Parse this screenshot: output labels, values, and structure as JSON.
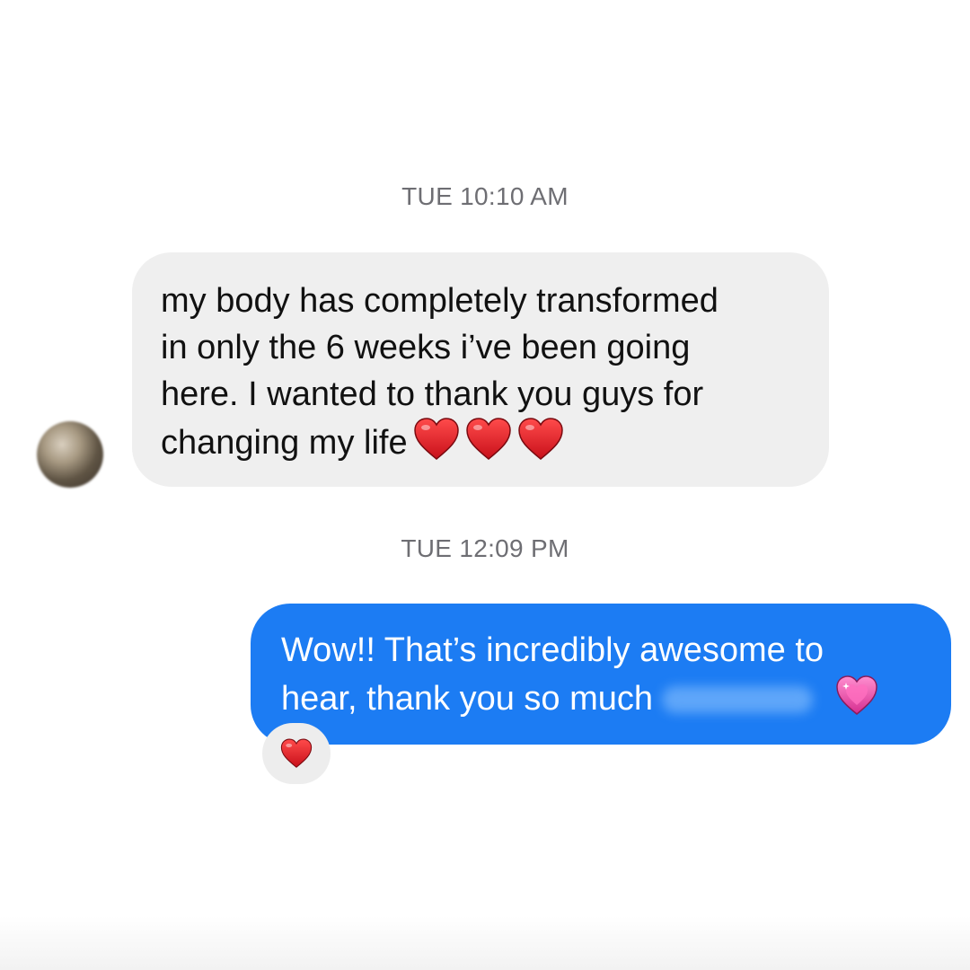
{
  "conversation": {
    "messages": [
      {
        "timestamp": "TUE 10:10 AM",
        "direction": "incoming",
        "lines": [
          "my body has completely transformed",
          "in only the 6 weeks i’ve been going",
          "here. I wanted to thank you guys for",
          "changing my life"
        ],
        "trailing_emoji": [
          "red-heart-icon",
          "red-heart-icon",
          "red-heart-icon"
        ]
      },
      {
        "timestamp": "TUE 12:09 PM",
        "direction": "outgoing",
        "lines": [
          "Wow!! That’s incredibly awesome to",
          "hear, thank you so much"
        ],
        "trailing_emoji": [
          "sparkling-pink-heart-icon"
        ],
        "reaction": "red-heart-icon"
      }
    ]
  },
  "colors": {
    "incoming_bubble": "#efefef",
    "outgoing_bubble": "#1c7cf3",
    "timestamp_text": "#6e6e73"
  }
}
